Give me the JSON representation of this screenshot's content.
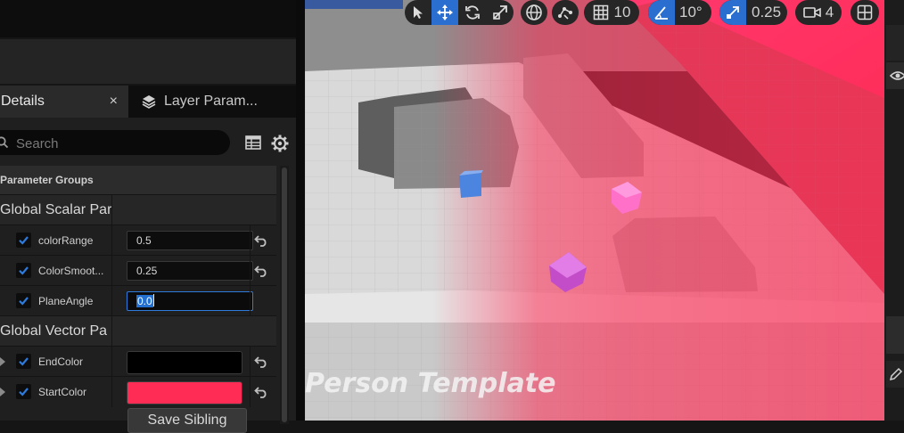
{
  "details_panel": {
    "tabs": [
      {
        "label": "Details",
        "close": "×"
      },
      {
        "label": "Layer Param..."
      }
    ],
    "search_placeholder": "Search",
    "param_groups_header": "Parameter Groups",
    "categories": [
      {
        "label": "Global Scalar Par"
      },
      {
        "label": "Global Vector Pa"
      }
    ],
    "scalar_params": [
      {
        "name": "colorRange",
        "value": "0.5"
      },
      {
        "name": "ColorSmoot...",
        "value": "0.25"
      },
      {
        "name": "PlaneAngle",
        "value": "0.0"
      }
    ],
    "vector_params": [
      {
        "name": "EndColor",
        "color": "#000000"
      },
      {
        "name": "StartColor",
        "color": "#ff2d55"
      }
    ],
    "save_sibling": "Save Sibling"
  },
  "viewport": {
    "toolbar": {
      "grid_snap": "10",
      "rotation_snap": "10°",
      "scale_snap": "0.25",
      "camera_speed": "4"
    },
    "watermark": "Person Template"
  },
  "colors": {
    "accent": "#2a6fd0",
    "panel_bg": "#1f1f1f",
    "checkbox_blue": "#2f7bdc"
  }
}
